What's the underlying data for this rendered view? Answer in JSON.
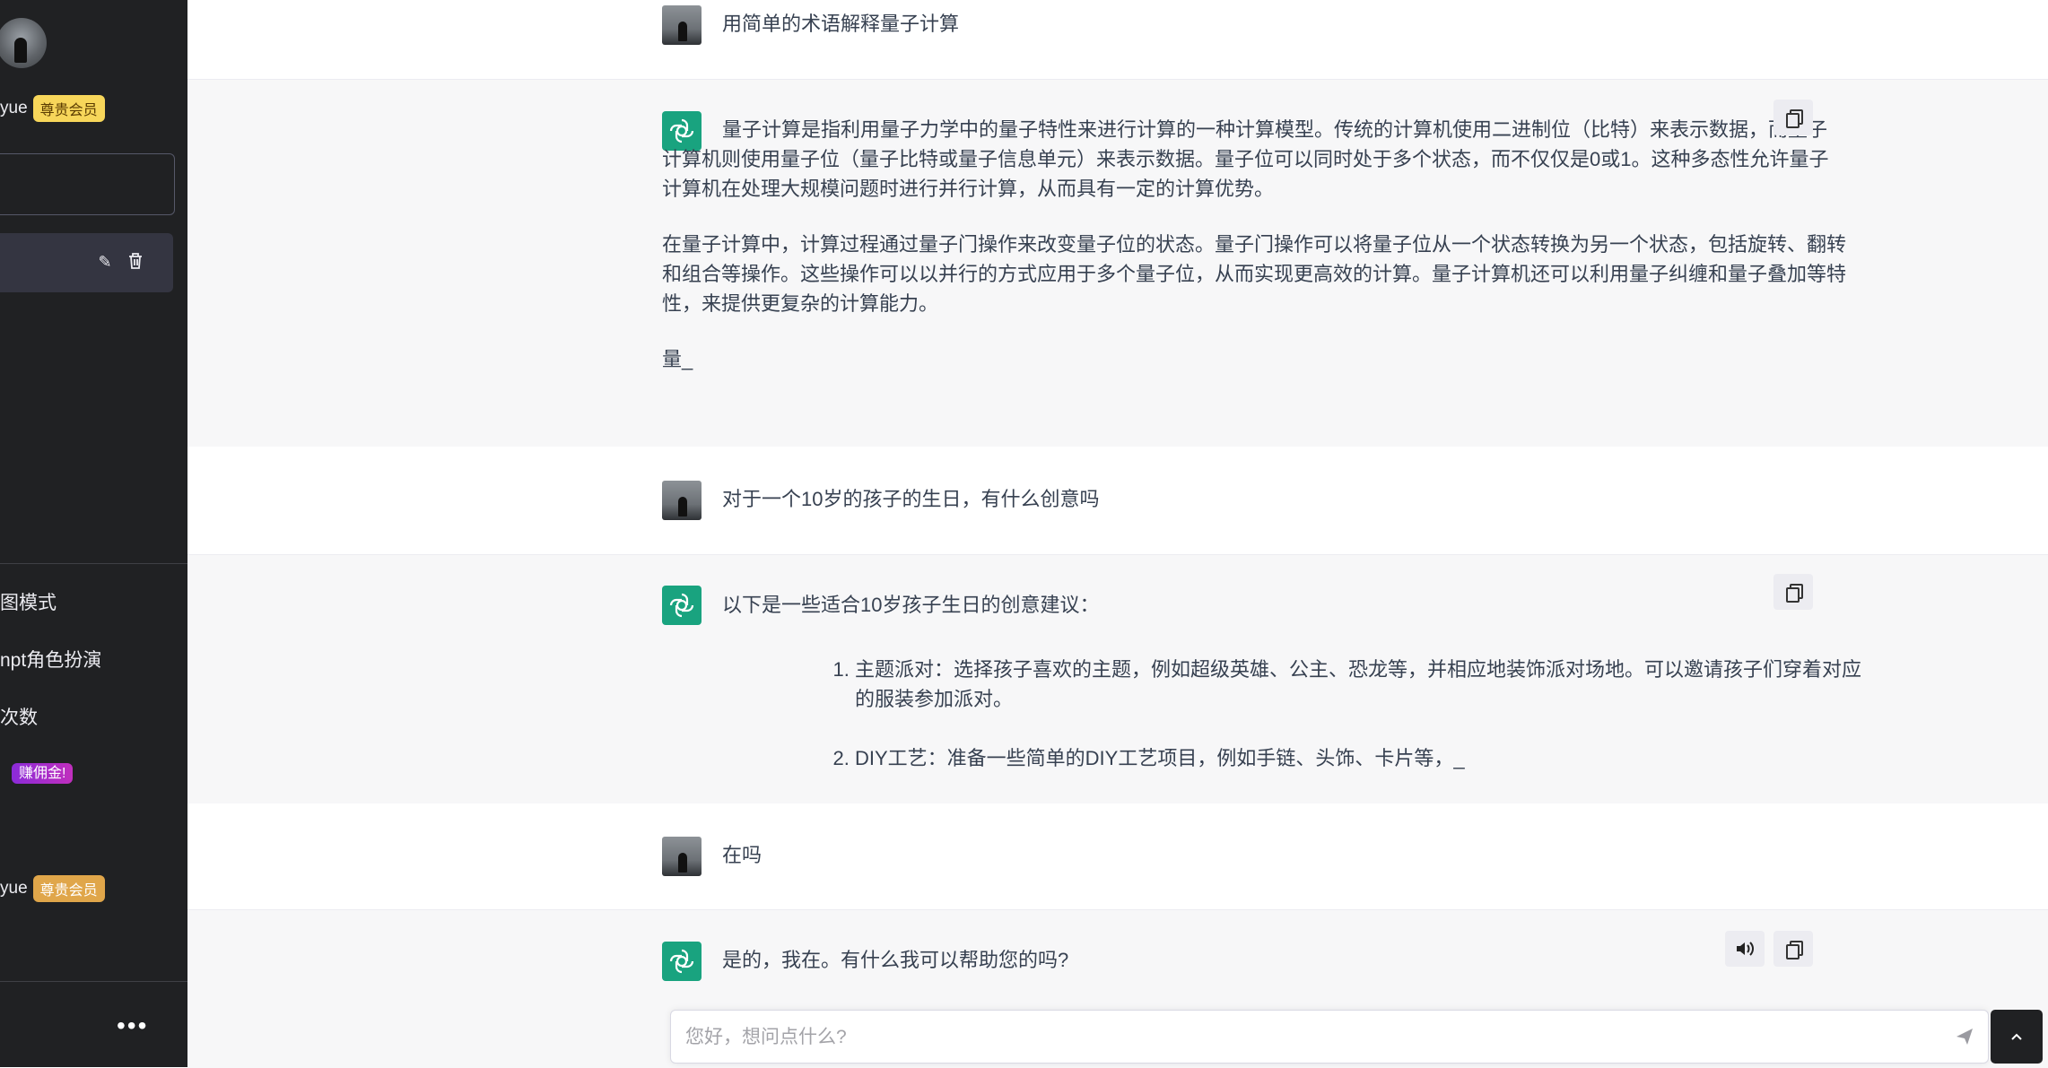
{
  "sidebar": {
    "username": "yue",
    "vip_badge": "尊贵会员",
    "menu": [
      {
        "label": "图模式"
      },
      {
        "label": "npt角色扮演"
      },
      {
        "label": "次数"
      },
      {
        "label": "",
        "badge": "赚佣金!"
      }
    ],
    "bottom_user": {
      "username": "yue",
      "badge": "尊贵会员"
    },
    "more_label": "•••"
  },
  "conversation": {
    "q1": "用简单的术语解释量子计算",
    "a1": {
      "p1": "量子计算是指利用量子力学中的量子特性来进行计算的一种计算模型。传统的计算机使用二进制位（比特）来表示数据，而量子计算机则使用量子位（量子比特或量子信息单元）来表示数据。量子位可以同时处于多个状态，而不仅仅是0或1。这种多态性允许量子计算机在处理大规模问题时进行并行计算，从而具有一定的计算优势。",
      "p2": "在量子计算中，计算过程通过量子门操作来改变量子位的状态。量子门操作可以将量子位从一个状态转换为另一个状态，包括旋转、翻转和组合等操作。这些操作可以以并行的方式应用于多个量子位，从而实现更高效的计算。量子计算机还可以利用量子纠缠和量子叠加等特性，来提供更复杂的计算能力。",
      "p3": "量_"
    },
    "q2": "对于一个10岁的孩子的生日，有什么创意吗",
    "a2": {
      "intro": "以下是一些适合10岁孩子生日的创意建议：",
      "items": [
        "主题派对：选择孩子喜欢的主题，例如超级英雄、公主、恐龙等，并相应地装饰派对场地。可以邀请孩子们穿着对应的服装参加派对。",
        "DIY工艺：准备一些简单的DIY工艺项目，例如手链、头饰、卡片等，_"
      ]
    },
    "q3": "在吗",
    "a3": "是的，我在。有什么我可以帮助您的吗?"
  },
  "input": {
    "placeholder": "您好，想问点什么?"
  },
  "colors": {
    "sidebar_bg": "#202123",
    "bot_row_bg": "#f7f7f8",
    "assistant_avatar": "#19a37f"
  }
}
